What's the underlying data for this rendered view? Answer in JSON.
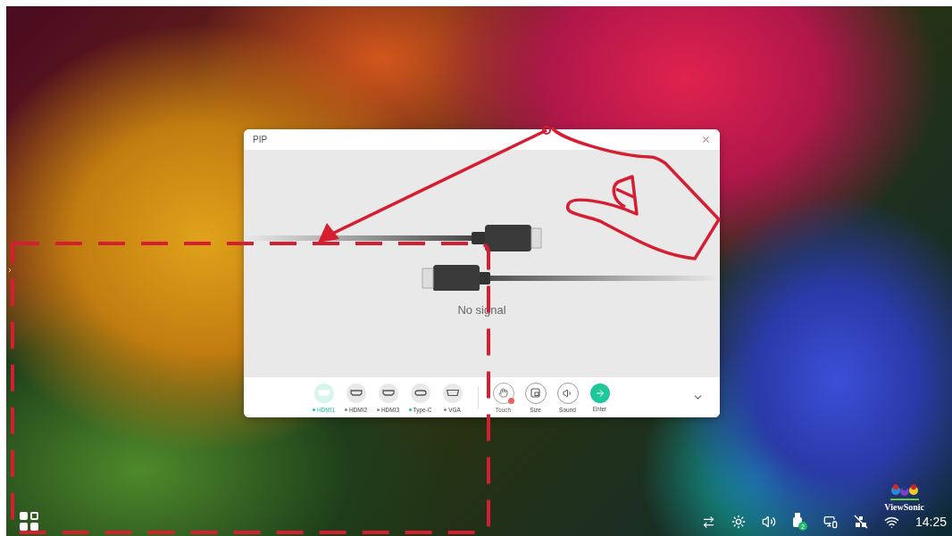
{
  "window": {
    "title": "PIP",
    "message": "No signal"
  },
  "sources": [
    {
      "label": "HDMI1",
      "kind": "hdmi",
      "selected": true,
      "connected": true
    },
    {
      "label": "HDMI2",
      "kind": "hdmi",
      "selected": false,
      "connected": false
    },
    {
      "label": "HDMI3",
      "kind": "hdmi",
      "selected": false,
      "connected": false
    },
    {
      "label": "Type-C",
      "kind": "typec",
      "selected": false,
      "connected": true
    },
    {
      "label": "VGA",
      "kind": "vga",
      "selected": false,
      "connected": false
    }
  ],
  "actions": [
    {
      "label": "Touch",
      "kind": "touch",
      "disabled": true
    },
    {
      "label": "Size",
      "kind": "size",
      "disabled": false
    },
    {
      "label": "Sound",
      "kind": "sound",
      "disabled": false
    },
    {
      "label": "Enter",
      "kind": "enter",
      "disabled": false
    }
  ],
  "taskbar": {
    "usb_badge": "2",
    "clock": "14:25"
  },
  "logo": {
    "text": "ViewSonic"
  }
}
